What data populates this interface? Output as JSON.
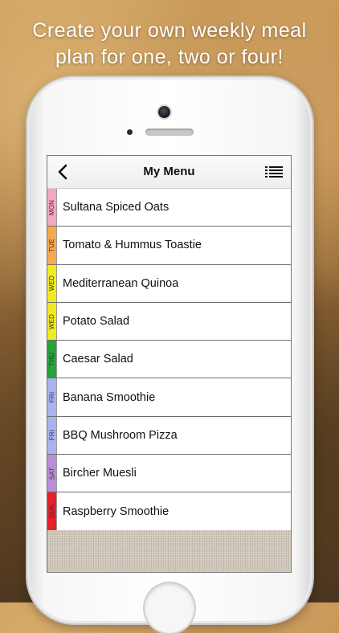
{
  "headline": {
    "line1": "Create your own weekly meal",
    "line2": "plan for one, two or four!"
  },
  "navbar": {
    "title": "My Menu",
    "back_icon": "chevron-left-icon",
    "list_icon": "list-icon"
  },
  "menu_items": [
    {
      "day": "MON",
      "meal": "Sultana Spiced Oats",
      "color": "#f4a6c2"
    },
    {
      "day": "TUE",
      "meal": "Tomato & Hummus Toastie",
      "color": "#f6a94f"
    },
    {
      "day": "WED",
      "meal": "Mediterranean Quinoa",
      "color": "#f2ea1f"
    },
    {
      "day": "WED",
      "meal": "Potato Salad",
      "color": "#f2ea1f"
    },
    {
      "day": "THU",
      "meal": "Caesar Salad",
      "color": "#26a33a"
    },
    {
      "day": "FRI",
      "meal": "Banana Smoothie",
      "color": "#a8b3f2"
    },
    {
      "day": "FRI",
      "meal": "BBQ Mushroom Pizza",
      "color": "#a8b3f2"
    },
    {
      "day": "SAT",
      "meal": "Bircher Muesli",
      "color": "#b88ed9"
    },
    {
      "day": "SUN",
      "meal": "Raspberry Smoothie",
      "color": "#e8202a"
    }
  ]
}
